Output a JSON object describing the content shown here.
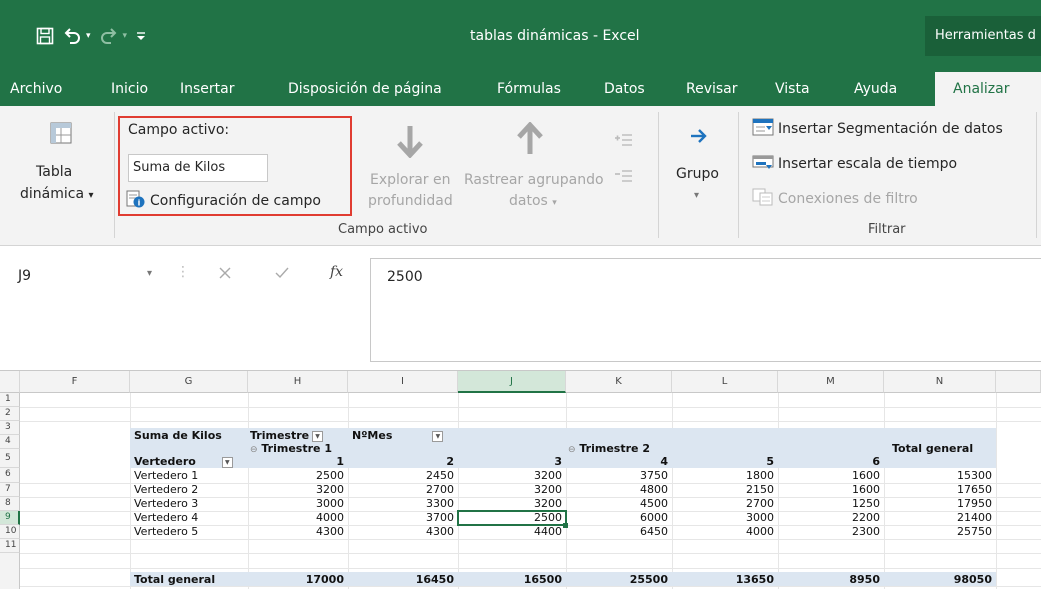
{
  "titlebar": {
    "title": "tablas dinámicas  -  Excel",
    "context_tab": "Herramientas d"
  },
  "qat": {
    "save_icon": "save-icon",
    "undo_icon": "undo-icon",
    "redo_icon": "redo-icon",
    "customize_icon": "customize-qat-icon"
  },
  "tabs": [
    "Archivo",
    "Inicio",
    "Insertar",
    "Disposición de página",
    "Fórmulas",
    "Datos",
    "Revisar",
    "Vista",
    "Ayuda",
    "Analizar"
  ],
  "active_tab": "Analizar",
  "ribbon": {
    "tabla_dinamica": [
      "Tabla",
      "dinámica"
    ],
    "campo_activo_label": "Campo activo:",
    "campo_activo_value": "Suma de Kilos",
    "configuracion": "Configuración de campo",
    "explorar": [
      "Explorar en",
      "profundidad"
    ],
    "rastrear": [
      "Rastrear agrupando",
      "datos"
    ],
    "group_campo_activo": "Campo activo",
    "grupo": "Grupo",
    "insertar_segmentacion": "Insertar Segmentación de datos",
    "insertar_escala": "Insertar escala de tiempo",
    "conexiones": "Conexiones de filtro",
    "group_filtrar": "Filtrar"
  },
  "formula_bar": {
    "name_box": "J9",
    "fx": "fx",
    "value": "2500"
  },
  "sheet": {
    "columns": [
      "F",
      "G",
      "H",
      "I",
      "J",
      "K",
      "L",
      "M",
      "N"
    ],
    "rows": [
      "1",
      "2",
      "3",
      "4",
      "5",
      "6",
      "7",
      "8",
      "9",
      "10",
      "11"
    ],
    "selected_cell": "J9",
    "pivot": {
      "corner": "Suma de Kilos",
      "col_field_1": "Trimestre",
      "col_field_2": "NºMes",
      "trimestre_1": "Trimestre 1",
      "trimestre_2": "Trimestre 2",
      "total_general_col": "Total general",
      "row_field": "Vertedero",
      "months": [
        "1",
        "2",
        "3",
        "4",
        "5",
        "6"
      ],
      "body": [
        {
          "label": "Vertedero 1",
          "values": [
            "2500",
            "2450",
            "3200",
            "3750",
            "1800",
            "1600",
            "15300"
          ]
        },
        {
          "label": "Vertedero 2",
          "values": [
            "3200",
            "2700",
            "3200",
            "4800",
            "2150",
            "1600",
            "17650"
          ]
        },
        {
          "label": "Vertedero 3",
          "values": [
            "3000",
            "3300",
            "3200",
            "4500",
            "2700",
            "1250",
            "17950"
          ]
        },
        {
          "label": "Vertedero 4",
          "values": [
            "4000",
            "3700",
            "2500",
            "6000",
            "3000",
            "2200",
            "21400"
          ]
        },
        {
          "label": "Vertedero 5",
          "values": [
            "4300",
            "4300",
            "4400",
            "6450",
            "4000",
            "2300",
            "25750"
          ]
        }
      ],
      "total_row": {
        "label": "Total general",
        "values": [
          "17000",
          "16450",
          "16500",
          "25500",
          "13650",
          "8950",
          "98050"
        ]
      }
    }
  },
  "colors": {
    "excel_green": "#217346",
    "highlight_red": "#e03c31",
    "pivot_band": "#dce6f1"
  }
}
